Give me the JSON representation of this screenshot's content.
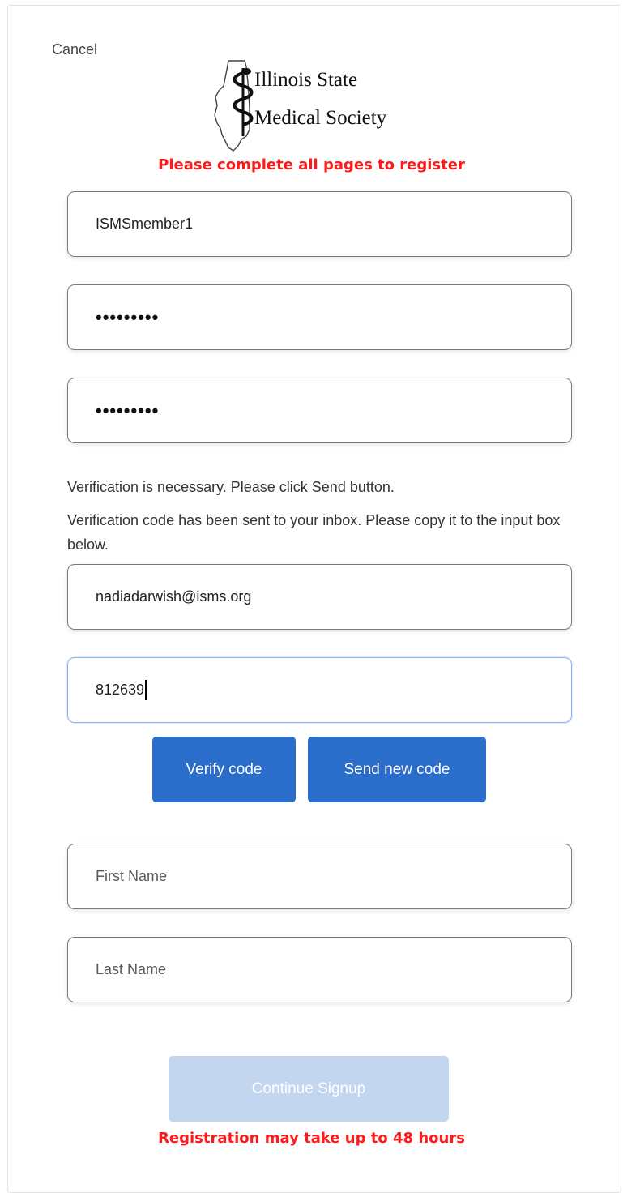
{
  "header": {
    "cancel_label": "Cancel",
    "logo_line1": "Illinois State",
    "logo_line2": "Medical Society"
  },
  "notice_top": "Please complete all pages to register",
  "fields": {
    "username_value": "ISMSmember1",
    "password_masked": "•••••••••",
    "confirm_password_masked": "•••••••••",
    "email_value": "nadiadarwish@isms.org",
    "code_value": "812639",
    "first_name_placeholder": "First Name",
    "last_name_placeholder": "Last Name"
  },
  "verification": {
    "line1": "Verification is necessary. Please click Send button.",
    "line2": "Verification code has been sent to your inbox. Please copy it to the input box below."
  },
  "buttons": {
    "verify_code": "Verify code",
    "send_new_code": "Send new code",
    "continue_signup": "Continue Signup"
  },
  "notice_bottom": "Registration may take up to 48 hours",
  "colors": {
    "primary_button": "#2a6dcb",
    "disabled_button": "#c3d6ef",
    "notice_red": "#ff1a1a"
  }
}
